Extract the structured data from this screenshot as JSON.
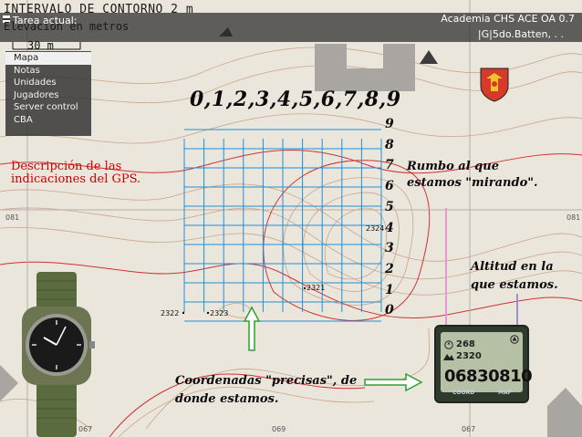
{
  "hud": {
    "task_label": "Tarea actual:",
    "server_name": "Academia CHS ACE OA 0.7",
    "player_name": "|G|5do.Batten, . ."
  },
  "legend": {
    "title": "INTERVALO DE CONTORNO 2 m",
    "subtitle": "Elevación en metros",
    "scale_label": "30 m"
  },
  "menu": {
    "items": [
      {
        "label": "Mapa",
        "active": true
      },
      {
        "label": "Notas"
      },
      {
        "label": "Unidades"
      },
      {
        "label": "Jugadores"
      },
      {
        "label": "Server control"
      },
      {
        "label": "CBA"
      }
    ]
  },
  "annotations": {
    "description": [
      "Descripción de las",
      "indicaciones del GPS."
    ],
    "digits": "0,1,2,3,4,5,6,7,8,9",
    "grid_numbers": [
      "9",
      "8",
      "7",
      "6",
      "5",
      "4",
      "3",
      "2",
      "1",
      "0"
    ],
    "rumbo": [
      "Rumbo al que",
      "estamos \"mirando\"."
    ],
    "altitud": [
      "Altitud en la",
      "que estamos."
    ],
    "coords": [
      "Coordenadas \"precisas\", de",
      "donde estamos."
    ]
  },
  "elevations": [
    "2321",
    "2322",
    "2323",
    "2324"
  ],
  "grid_refs": [
    "081",
    "081",
    "067",
    "067",
    "069"
  ],
  "gps": {
    "heading": "268",
    "altitude": "2320",
    "coordinates": "06830810",
    "soft_left": "COORD",
    "soft_right": "MAP"
  },
  "colors": {
    "map_bg": "#ebe6dc",
    "contour_brown": "#c8a58a",
    "contour_red": "#cc3333",
    "grid_blue": "#1c8fd8",
    "arrow_green": "#2fa02f",
    "arrow_pink": "#e49ad0",
    "arrow_purple": "#9b8fd6",
    "annotation_red": "#cc0000"
  }
}
